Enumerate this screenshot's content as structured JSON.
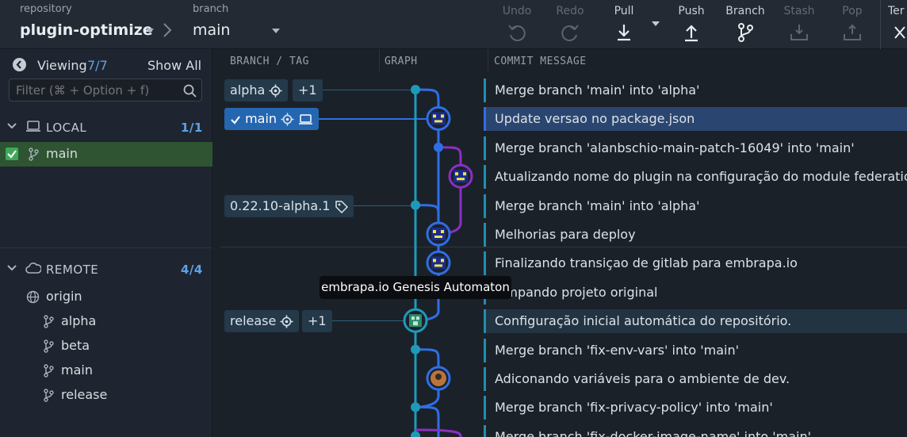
{
  "toolbar": {
    "repository_caption": "repository",
    "repository_name": "plugin-optimize",
    "branch_caption": "branch",
    "branch_name": "main",
    "buttons": [
      {
        "label": "Undo",
        "enabled": false,
        "icon": "undo-icon"
      },
      {
        "label": "Redo",
        "enabled": false,
        "icon": "redo-icon"
      },
      {
        "label": "Pull",
        "enabled": true,
        "icon": "pull-icon"
      },
      {
        "label": "Push",
        "enabled": true,
        "icon": "push-icon"
      },
      {
        "label": "Branch",
        "enabled": true,
        "icon": "branch-icon"
      },
      {
        "label": "Stash",
        "enabled": false,
        "icon": "stash-icon"
      },
      {
        "label": "Pop",
        "enabled": false,
        "icon": "pop-icon"
      },
      {
        "label": "Ter",
        "enabled": true,
        "icon": "close-icon"
      }
    ]
  },
  "sidebar": {
    "viewing_label": "Viewing",
    "viewing_count": "7/7",
    "show_all": "Show All",
    "filter_placeholder": "Filter (⌘ + Option + f)",
    "local": {
      "title": "LOCAL",
      "count": "1/1",
      "items": [
        {
          "label": "main",
          "checked": true
        }
      ]
    },
    "remote": {
      "title": "REMOTE",
      "count": "4/4",
      "origin": "origin",
      "items": [
        {
          "label": "alpha"
        },
        {
          "label": "beta"
        },
        {
          "label": "main"
        },
        {
          "label": "release"
        }
      ]
    }
  },
  "columns": {
    "branch_tag": "BRANCH / TAG",
    "graph": "GRAPH",
    "commit_message": "COMMIT MESSAGE"
  },
  "commits": [
    {
      "message": "Merge branch 'main' into 'alpha'",
      "refs": [
        {
          "label": "alpha",
          "icon": "target-icon"
        },
        {
          "label": "+1"
        }
      ]
    },
    {
      "message": "Update versao no package.json",
      "refs": [
        {
          "label": "main",
          "icon": "target-icon",
          "selected": true
        }
      ],
      "selected": true
    },
    {
      "message": "Merge branch 'alanbschio-main-patch-16049' into 'main'",
      "refs": []
    },
    {
      "message": "Atualizando nome do plugin na configuração do module federation",
      "refs": []
    },
    {
      "message": "Merge branch 'main' into 'alpha'",
      "refs": [
        {
          "label": "0.22.10-alpha.1",
          "icon": "tag-icon"
        }
      ]
    },
    {
      "message": "Melhorias para deploy",
      "refs": []
    },
    {
      "message": "Finalizando transiçao de gitlab para embrapa.io",
      "refs": []
    },
    {
      "message": "Limpando projeto original",
      "refs": []
    },
    {
      "message": "Configuração inicial automática do repositório.",
      "refs": [
        {
          "label": "release",
          "icon": "target-icon"
        },
        {
          "label": "+1"
        }
      ]
    },
    {
      "message": "Merge branch 'fix-env-vars' into 'main'",
      "refs": []
    },
    {
      "message": "Adiconando variáveis para o ambiente de dev.",
      "refs": []
    },
    {
      "message": "Merge branch 'fix-privacy-policy' into 'main'",
      "refs": []
    },
    {
      "message": "Merge branch 'fix-docker-image-name' into 'main'",
      "refs": []
    }
  ],
  "tooltip": "embrapa.io Genesis Automaton",
  "colors": {
    "accent": "#2566b0",
    "local_selected": "#2e5431",
    "graph_teal": "#1e9ab8",
    "graph_blue": "#2f6ee6",
    "graph_purple": "#8a2fc4"
  }
}
